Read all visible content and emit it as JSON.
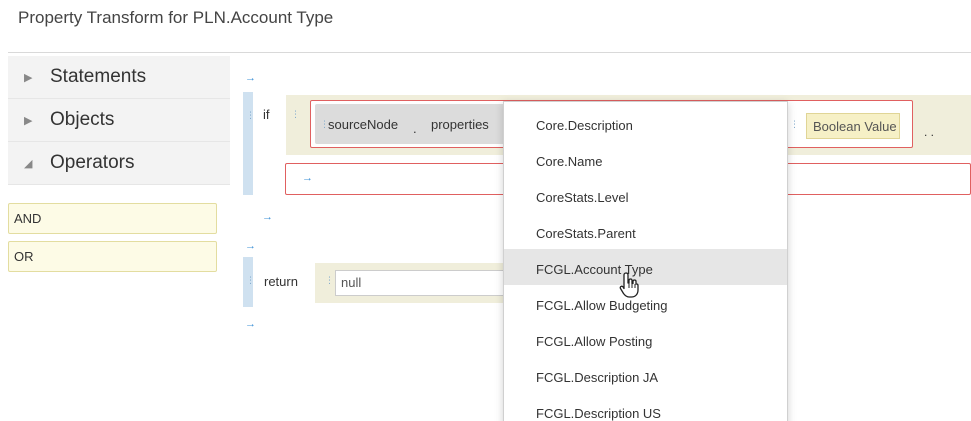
{
  "title": "Property Transform for PLN.Account Type",
  "palette": {
    "categories": [
      {
        "label": "Statements",
        "expanded": false
      },
      {
        "label": "Objects",
        "expanded": false
      },
      {
        "label": "Operators",
        "expanded": true
      }
    ],
    "operators": [
      "AND",
      "OR"
    ]
  },
  "editor": {
    "if_keyword": "if",
    "condition": {
      "source": "sourceNode",
      "separator": ".",
      "properties": "properties",
      "value_placeholder": "Boolean Value",
      "more": ". ."
    },
    "statement_slot_arrow": "→",
    "return_keyword": "return",
    "return_value": "null"
  },
  "dropdown": {
    "items": [
      "Core.Description",
      "Core.Name",
      "CoreStats.Level",
      "CoreStats.Parent",
      "FCGL.Account Type",
      "FCGL.Allow Budgeting",
      "FCGL.Allow Posting",
      "FCGL.Description JA",
      "FCGL.Description US"
    ],
    "hovered": "FCGL.Account Type"
  },
  "icons": {
    "arrow": "right-arrow-icon",
    "grip": "drag-handle-icon",
    "pointer": "hand-pointer-icon"
  },
  "colors": {
    "accent_blue": "#3a8fd6",
    "error_red": "#e06060",
    "block_bg": "#f0eedb",
    "operator_bg": "#fdfbe6"
  }
}
